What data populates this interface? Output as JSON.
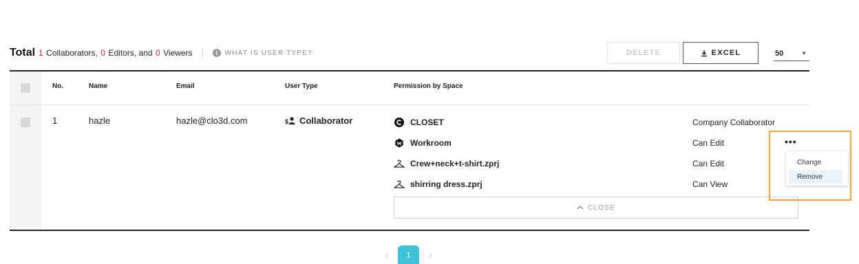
{
  "summary": {
    "total_label": "Total",
    "collab_count": "1",
    "collab_label": "Collaborators,",
    "editors_count": "0",
    "editors_label": "Editors, and",
    "viewers_count": "0",
    "viewers_label": "Viewers",
    "info_icon": "i",
    "what_is_label": "WHAT IS USER TYPE?"
  },
  "toolbar": {
    "delete_label": "DELETE",
    "excel_label": "EXCEL",
    "page_size": "50"
  },
  "table": {
    "columns": {
      "no": "No.",
      "name": "Name",
      "email": "Email",
      "user_type": "User Type",
      "permission": "Permission by Space"
    },
    "rows": [
      {
        "no": "1",
        "name": "hazle",
        "email": "hazle@clo3d.com",
        "user_type_icon": "$",
        "user_type": "Collaborator",
        "permissions": [
          {
            "space": "CLOSET",
            "icon": "closet-icon",
            "value": "Company Collaborator"
          },
          {
            "space": "Workroom",
            "icon": "workroom-icon",
            "value": "Can Edit"
          },
          {
            "space": "Crew+neck+t-shirt.zprj",
            "icon": "hanger-icon",
            "value": "Can Edit"
          },
          {
            "space": "shirring dress.zprj",
            "icon": "hanger-icon",
            "value": "Can View"
          }
        ],
        "close_label": "CLOSE"
      }
    ]
  },
  "menu": {
    "more_label": "•••",
    "items": [
      "Change",
      "Remove"
    ],
    "active": "Remove"
  },
  "pagination": {
    "current_page": "1",
    "prev": "‹",
    "next": "›"
  },
  "colors": {
    "accent": "#3ec3d6",
    "count_red": "#e02020",
    "highlight": "#f4a53a"
  }
}
